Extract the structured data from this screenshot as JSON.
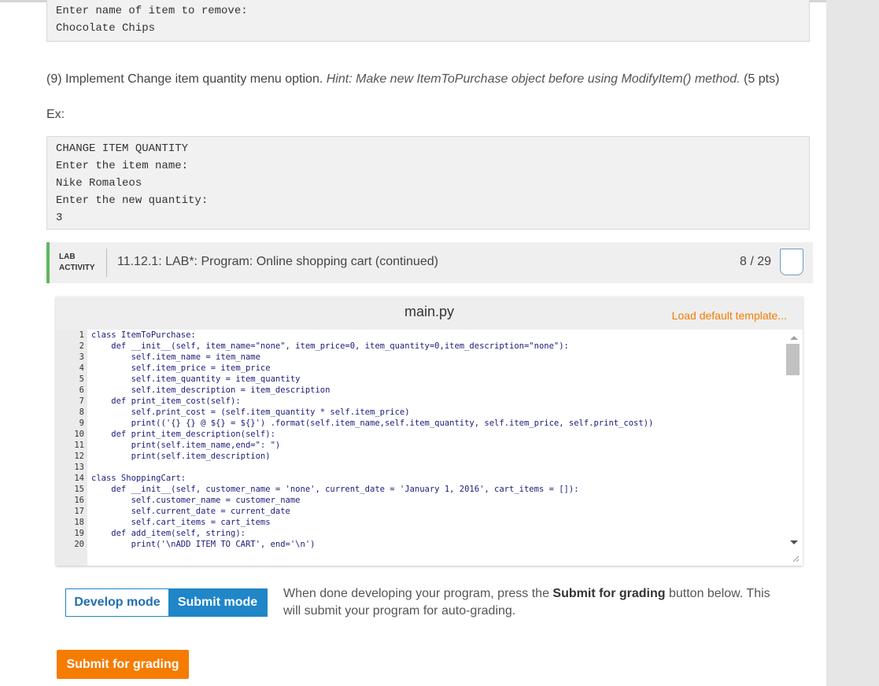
{
  "top_example": {
    "lines": [
      "Enter name of item to remove:",
      "Chocolate Chips"
    ]
  },
  "step9": {
    "prefix": "(9) Implement Change item quantity menu option. ",
    "hint": "Hint: Make new ItemToPurchase object before using ModifyItem() method.",
    "points": " (5 pts)"
  },
  "ex_label": "Ex:",
  "example": {
    "lines": [
      "CHANGE ITEM QUANTITY",
      "Enter the item name:",
      "Nike Romaleos",
      "Enter the new quantity:",
      "3"
    ]
  },
  "lab": {
    "tag_line1": "LAB",
    "tag_line2": "ACTIVITY",
    "title": "11.12.1: LAB*: Program: Online shopping cart (continued)",
    "score": "8 / 29",
    "accent_color": "#5cb85c"
  },
  "editor": {
    "file_name": "main.py",
    "load_template_label": "Load default template...",
    "code": [
      {
        "n": "1",
        "t": "class ItemToPurchase:"
      },
      {
        "n": "2",
        "t": "    def __init__(self, item_name=\"none\", item_price=0, item_quantity=0,item_description=\"none\"):"
      },
      {
        "n": "3",
        "t": "        self.item_name = item_name"
      },
      {
        "n": "4",
        "t": "        self.item_price = item_price"
      },
      {
        "n": "5",
        "t": "        self.item_quantity = item_quantity"
      },
      {
        "n": "6",
        "t": "        self.item_description = item_description"
      },
      {
        "n": "7",
        "t": "    def print_item_cost(self):"
      },
      {
        "n": "8",
        "t": "        self.print_cost = (self.item_quantity * self.item_price)"
      },
      {
        "n": "9",
        "t": "        print(('{} {} @ ${} = ${}') .format(self.item_name,self.item_quantity, self.item_price, self.print_cost))"
      },
      {
        "n": "10",
        "t": "    def print_item_description(self):"
      },
      {
        "n": "11",
        "t": "        print(self.item_name,end=\": \")"
      },
      {
        "n": "12",
        "t": "        print(self.item_description)"
      },
      {
        "n": "13",
        "t": ""
      },
      {
        "n": "14",
        "t": "class ShoppingCart:"
      },
      {
        "n": "15",
        "t": "    def __init__(self, customer_name = 'none', current_date = 'January 1, 2016', cart_items = []):"
      },
      {
        "n": "16",
        "t": "        self.customer_name = customer_name"
      },
      {
        "n": "17",
        "t": "        self.current_date = current_date"
      },
      {
        "n": "18",
        "t": "        self.cart_items = cart_items"
      },
      {
        "n": "19",
        "t": "    def add_item(self, string):"
      },
      {
        "n": "20",
        "t": "        print('\\nADD ITEM TO CART', end='\\n')"
      }
    ]
  },
  "modes": {
    "develop": "Develop mode",
    "submit": "Submit mode"
  },
  "help": {
    "part1": "When done developing your program, press the ",
    "bold": "Submit for grading",
    "part2": " button below. This will submit your program for auto-grading."
  },
  "submit_button": "Submit for grading"
}
